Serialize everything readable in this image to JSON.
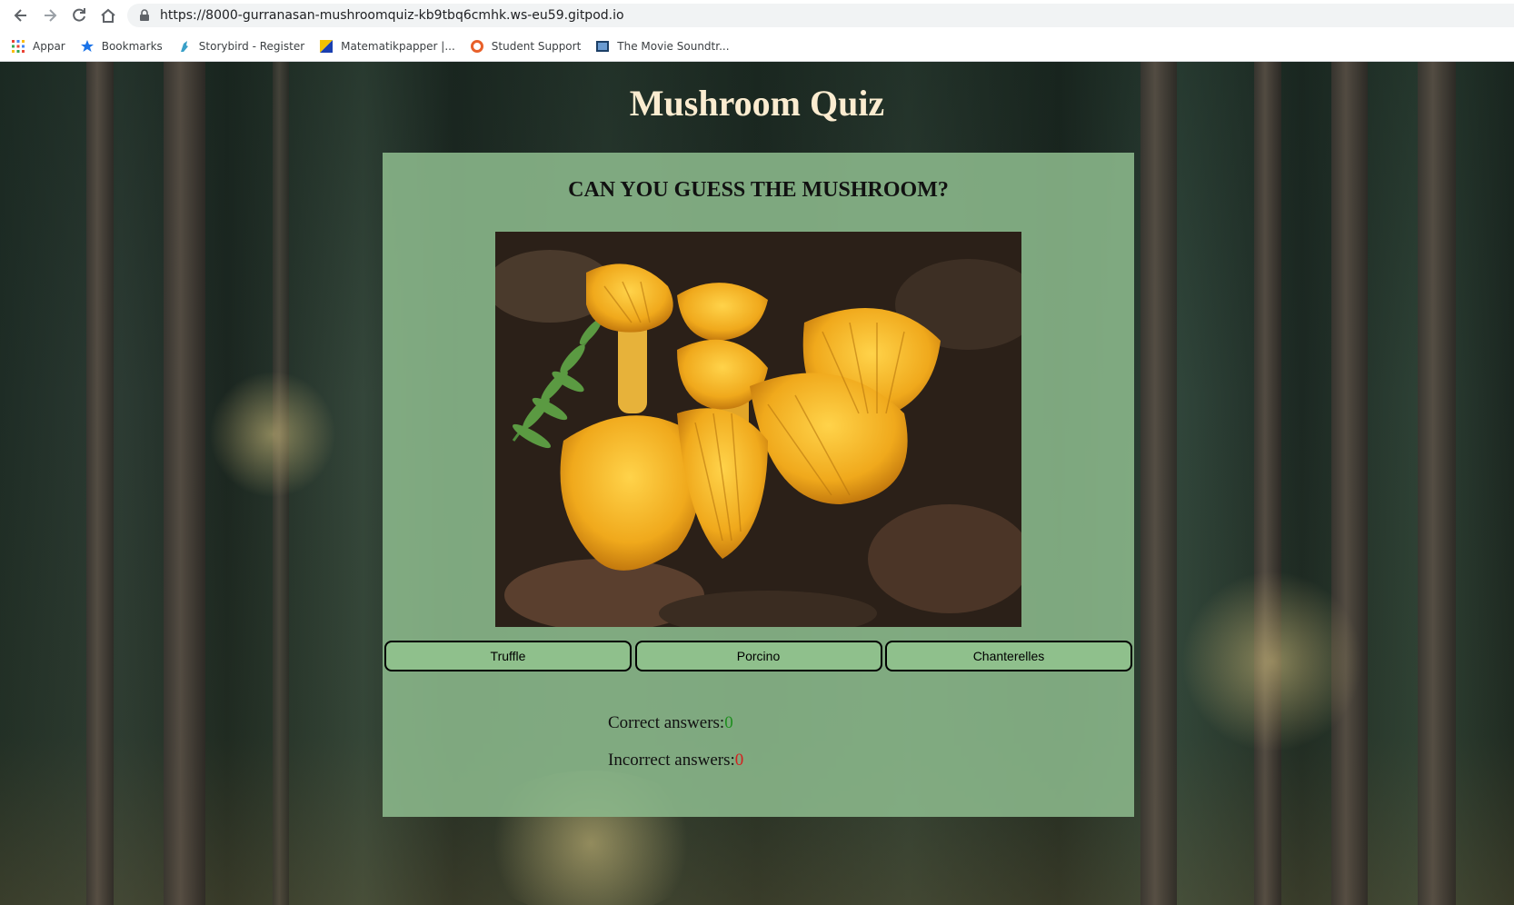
{
  "browser": {
    "url_host": "https://8000-gurranasan-mushroomquiz-kb9tbq6cmhk.ws-eu59.gitpod.io",
    "bookmarks": [
      {
        "label": "Appar",
        "icon": "apps-grid-icon"
      },
      {
        "label": "Bookmarks",
        "icon": "star-icon"
      },
      {
        "label": "Storybird - Register",
        "icon": "storybird-icon"
      },
      {
        "label": "Matematikpapper |...",
        "icon": "matematik-icon"
      },
      {
        "label": "Student Support",
        "icon": "ring-icon"
      },
      {
        "label": "The Movie Soundtr...",
        "icon": "film-icon"
      }
    ]
  },
  "page": {
    "title": "Mushroom Quiz",
    "question": "CAN YOU GUESS THE MUSHROOM?",
    "answers": [
      "Truffle",
      "Porcino",
      "Chanterelles"
    ],
    "score": {
      "correct_label": "Correct answers:",
      "correct_value": "0",
      "incorrect_label": "Incorrect answers:",
      "incorrect_value": "0"
    }
  },
  "colors": {
    "title": "#fbecd0",
    "quiz_box": "#8cb98c",
    "button_bg": "#8fc08c",
    "correct": "#1f8f1f",
    "incorrect": "#d42020"
  }
}
